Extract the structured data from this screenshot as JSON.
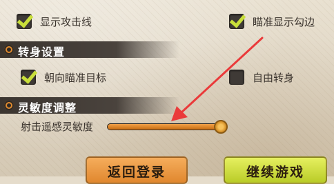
{
  "sections": {
    "turn": {
      "title": "转身设置"
    },
    "sensitivity": {
      "title": "灵敏度调整"
    }
  },
  "options": {
    "show_attack_line": {
      "label": "显示攻击线",
      "checked": true
    },
    "aim_outline": {
      "label": "瞄准显示勾边",
      "checked": true
    },
    "face_target": {
      "label": "朝向瞄准目标",
      "checked": true
    },
    "free_turn": {
      "label": "自由转身",
      "checked": false
    }
  },
  "slider": {
    "label": "射击遥感灵敏度",
    "value": 1.0
  },
  "buttons": {
    "back": "返回登录",
    "continue": "继续游戏"
  },
  "colors": {
    "check": "#c9df3a",
    "orange": "#e0872e",
    "annotation": "#ea3a3a"
  }
}
